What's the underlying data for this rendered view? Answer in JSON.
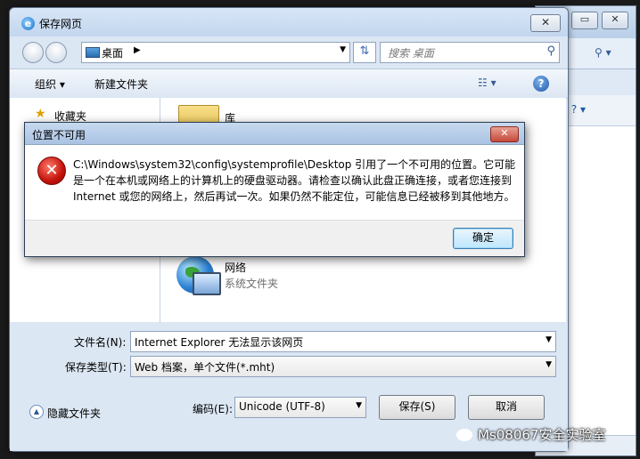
{
  "save_dialog": {
    "title": "保存网页",
    "close_glyph": "✕",
    "address": {
      "location": "桌面",
      "separator": "▶",
      "dropdown": "▼"
    },
    "search": {
      "placeholder": "搜索 桌面"
    },
    "refresh_glyph": "⇅",
    "toolbar": {
      "organize": "组织 ▾",
      "new_folder": "新建文件夹",
      "view_glyph": "☷ ▾",
      "help": "?"
    },
    "nav_pane": {
      "favorites": "收藏夹"
    },
    "items": [
      {
        "name": "库",
        "subtitle": ""
      },
      {
        "name": "网络",
        "subtitle": "系统文件夹"
      }
    ],
    "filename_label": "文件名(N):",
    "filename_value": "Internet Explorer 无法显示该网页",
    "filetype_label": "保存类型(T):",
    "filetype_value": "Web 档案，单个文件(*.mht)",
    "hide_folders": "隐藏文件夹",
    "encoding_label": "编码(E):",
    "encoding_value": "Unicode (UTF-8)",
    "save_button": "保存(S)",
    "cancel_button": "取消"
  },
  "error_dialog": {
    "title": "位置不可用",
    "close_glyph": "✕",
    "icon_glyph": "✕",
    "message_lines": [
      "C:\\Windows\\system32\\config\\systemprofile\\Desktop 引用了一个不可用的位置。它可能",
      "是一个在本机或网络上的计算机上的硬盘驱动器。请检查以确认此盘正确连接，或者您连接到",
      "Internet 或您的网络上，然后再试一次。如果仍然不能定位，可能信息已经被移到其他地方。"
    ],
    "ok_button": "确定"
  },
  "background_window": {
    "min_glyph": "▭",
    "close_glyph": "✕",
    "search_glyph": "⚲ ▾",
    "tools_glyph": "▾  ? ▾"
  },
  "watermark": "Ms08067安全实验室",
  "colors": {
    "error_red": "#c4120a",
    "accent_blue": "#1e56a8"
  }
}
